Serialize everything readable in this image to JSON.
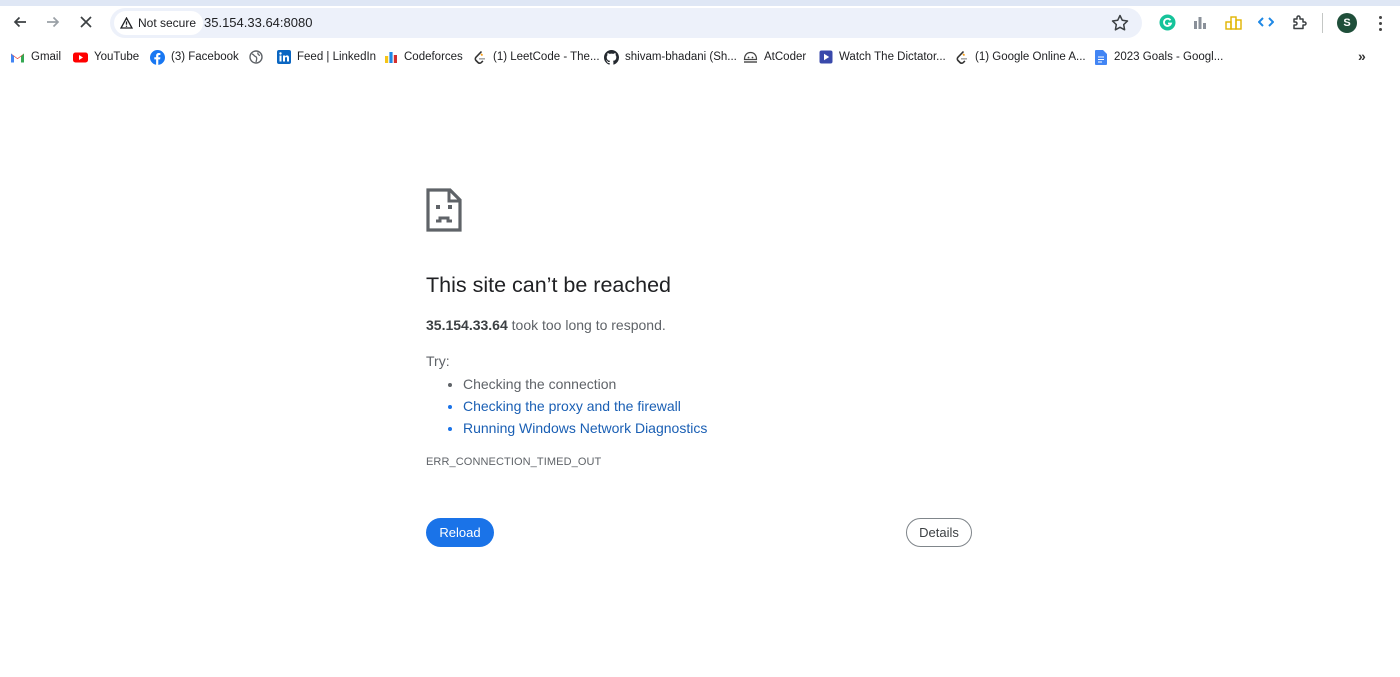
{
  "browser": {
    "security_chip": "Not secure",
    "url": "35.154.33.64:8080",
    "profile_initial": "S"
  },
  "bookmarks": [
    {
      "label": "Gmail",
      "icon": "gmail-icon"
    },
    {
      "label": "YouTube",
      "icon": "youtube-icon"
    },
    {
      "label": "(3) Facebook",
      "icon": "facebook-icon"
    },
    {
      "label": "",
      "icon": "globe-icon"
    },
    {
      "label": "Feed | LinkedIn",
      "icon": "linkedin-icon"
    },
    {
      "label": "Codeforces",
      "icon": "codeforces-icon"
    },
    {
      "label": "(1) LeetCode - The...",
      "icon": "leetcode-icon"
    },
    {
      "label": "shivam-bhadani (Sh...",
      "icon": "github-icon"
    },
    {
      "label": "AtCoder",
      "icon": "atcoder-icon"
    },
    {
      "label": "Watch The Dictator...",
      "icon": "video-icon"
    },
    {
      "label": "(1) Google Online A...",
      "icon": "leetcode-icon"
    },
    {
      "label": "2023 Goals - Googl...",
      "icon": "docs-icon"
    }
  ],
  "error": {
    "title": "This site can’t be reached",
    "host": "35.154.33.64",
    "message": " took too long to respond.",
    "try_label": "Try:",
    "suggestions": [
      "Checking the connection",
      "Checking the proxy and the firewall",
      "Running Windows Network Diagnostics"
    ],
    "code": "ERR_CONNECTION_TIMED_OUT",
    "reload_label": "Reload",
    "details_label": "Details"
  },
  "colors": {
    "accent": "#1a73e8",
    "omnibox_bg": "#edf1fa"
  }
}
